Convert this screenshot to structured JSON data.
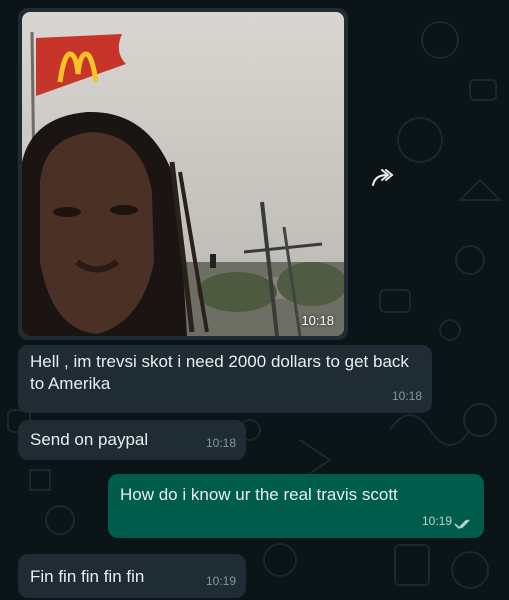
{
  "theme": {
    "background": "#0b1417",
    "incoming": "#1f2c33",
    "outgoing": "#005c4b",
    "flag": "#c7352a",
    "logo": "#f7c325"
  },
  "photo": {
    "time": "10:18",
    "icon": "forward-icon"
  },
  "messages": [
    {
      "direction": "incoming",
      "text": "Hell , im trevsi skot i need 2000 dollars to get back to Amerika",
      "time": "10:18"
    },
    {
      "direction": "incoming",
      "text": "Send on paypal",
      "time": "10:18"
    },
    {
      "direction": "outgoing",
      "text": "How do i know ur the real travis scott",
      "time": "10:19",
      "status": "read"
    },
    {
      "direction": "incoming",
      "text": "Fin fin fin fin fin",
      "time": "10:19"
    }
  ]
}
